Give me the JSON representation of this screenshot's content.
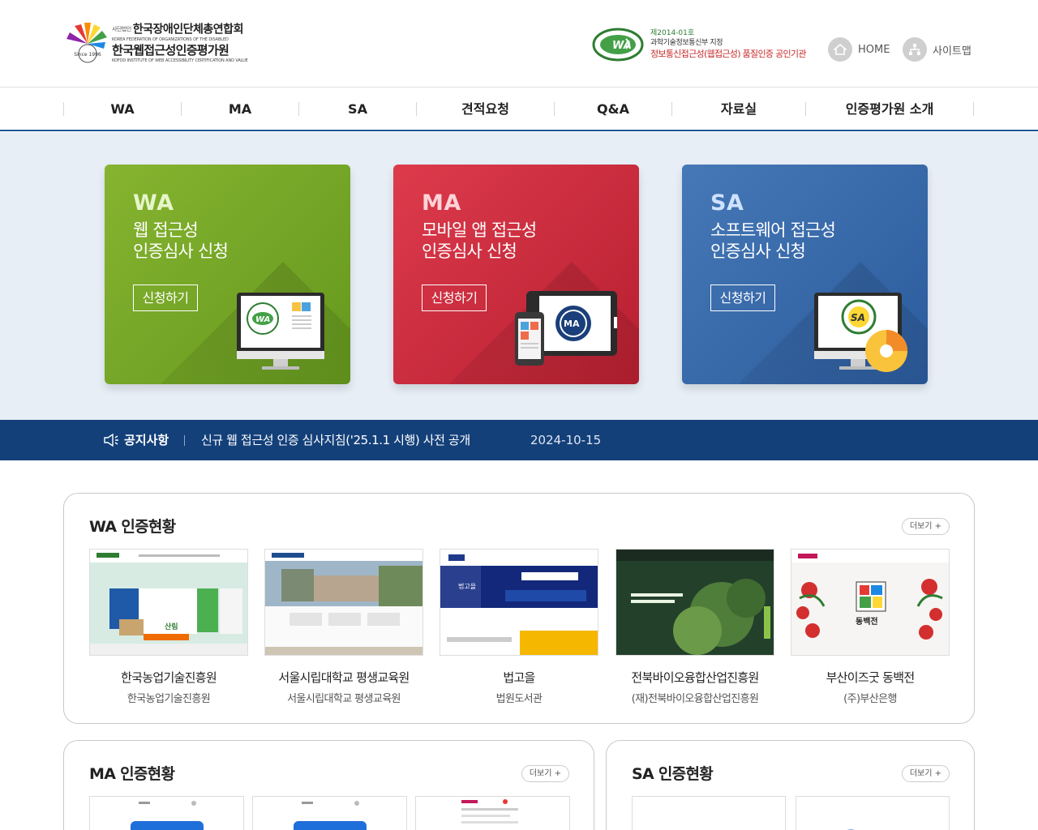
{
  "header": {
    "org_prefix": "사단법인",
    "org_name": "한국장애인단체총연합회",
    "org_eng": "KOREA FEDERATION OF ORGANIZATIONS OF THE DISABLED",
    "inst_name": "한국웹접근성인증평가원",
    "inst_eng": "KOFOD INSTITUTE OF WEB ACCESSIBILITY CERTIFICATION AND VALUE",
    "cert_no": "제2014-01호",
    "cert_by": "과학기술정보통신부 지정",
    "cert_main": "정보통신접근성(웹접근성) 품질인증 공인기관",
    "home_label": "HOME",
    "sitemap_label": "사이트맵"
  },
  "nav": {
    "items": [
      {
        "label": "WA"
      },
      {
        "label": "MA"
      },
      {
        "label": "SA"
      },
      {
        "label": "견적요청"
      },
      {
        "label": "Q&A"
      },
      {
        "label": "자료실"
      },
      {
        "label": "인증평가원 소개"
      }
    ]
  },
  "banner": {
    "cards": [
      {
        "abbr": "WA",
        "line1": "웹 접근성",
        "line2": "인증심사 신청",
        "button": "신청하기"
      },
      {
        "abbr": "MA",
        "line1": "모바일 앱 접근성",
        "line2": "인증심사 신청",
        "button": "신청하기"
      },
      {
        "abbr": "SA",
        "line1": "소프트웨어 접근성",
        "line2": "인증심사 신청",
        "button": "신청하기"
      }
    ]
  },
  "notice": {
    "label": "공지사항",
    "text": "신규 웹 접근성 인증 심사지침('25.1.1 시행) 사전 공개",
    "date": "2024-10-15"
  },
  "wa_section": {
    "title": "WA 인증현황",
    "more": "더보기 +",
    "sites": [
      {
        "name": "한국농업기술진흥원",
        "org": "한국농업기술진흥원"
      },
      {
        "name": "서울시립대학교 평생교육원",
        "org": "서울시립대학교 평생교육원"
      },
      {
        "name": "법고을",
        "org": "법원도서관"
      },
      {
        "name": "전북바이오융합산업진흥원",
        "org": "(재)전북바이오융합산업진흥원"
      },
      {
        "name": "부산이즈굿 동백전",
        "org": "(주)부산은행"
      }
    ]
  },
  "ma_section": {
    "title": "MA 인증현황",
    "more": "더보기 +"
  },
  "sa_section": {
    "title": "SA 인증현황",
    "more": "더보기 +"
  },
  "colors": {
    "nav_border": "#1e5799",
    "banner_bg": "#e7eef6",
    "wa_card": "#75a626",
    "ma_card": "#cc2c3e",
    "sa_card": "#3a6aab",
    "notice_bg": "#14407a"
  }
}
